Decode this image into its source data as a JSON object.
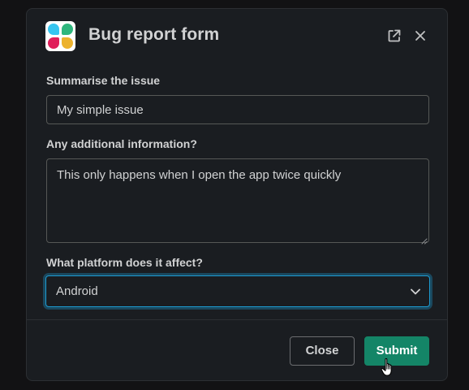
{
  "modal": {
    "title": "Bug report form",
    "logo_icon": "slack-app-logo",
    "header_icons": [
      "external-link-icon",
      "close-icon"
    ]
  },
  "form": {
    "summary": {
      "label": "Summarise the issue",
      "value": "My simple issue"
    },
    "details": {
      "label": "Any additional information?",
      "value": "This only happens when I open the app twice quickly"
    },
    "platform": {
      "label": "What platform does it affect?",
      "selected": "Android",
      "focused": true
    }
  },
  "footer": {
    "close_label": "Close",
    "submit_label": "Submit"
  },
  "colors": {
    "background": "#1a1d21",
    "text": "#d1d2d3",
    "submit": "#148567",
    "focus_ring": "#1d9bd1"
  }
}
